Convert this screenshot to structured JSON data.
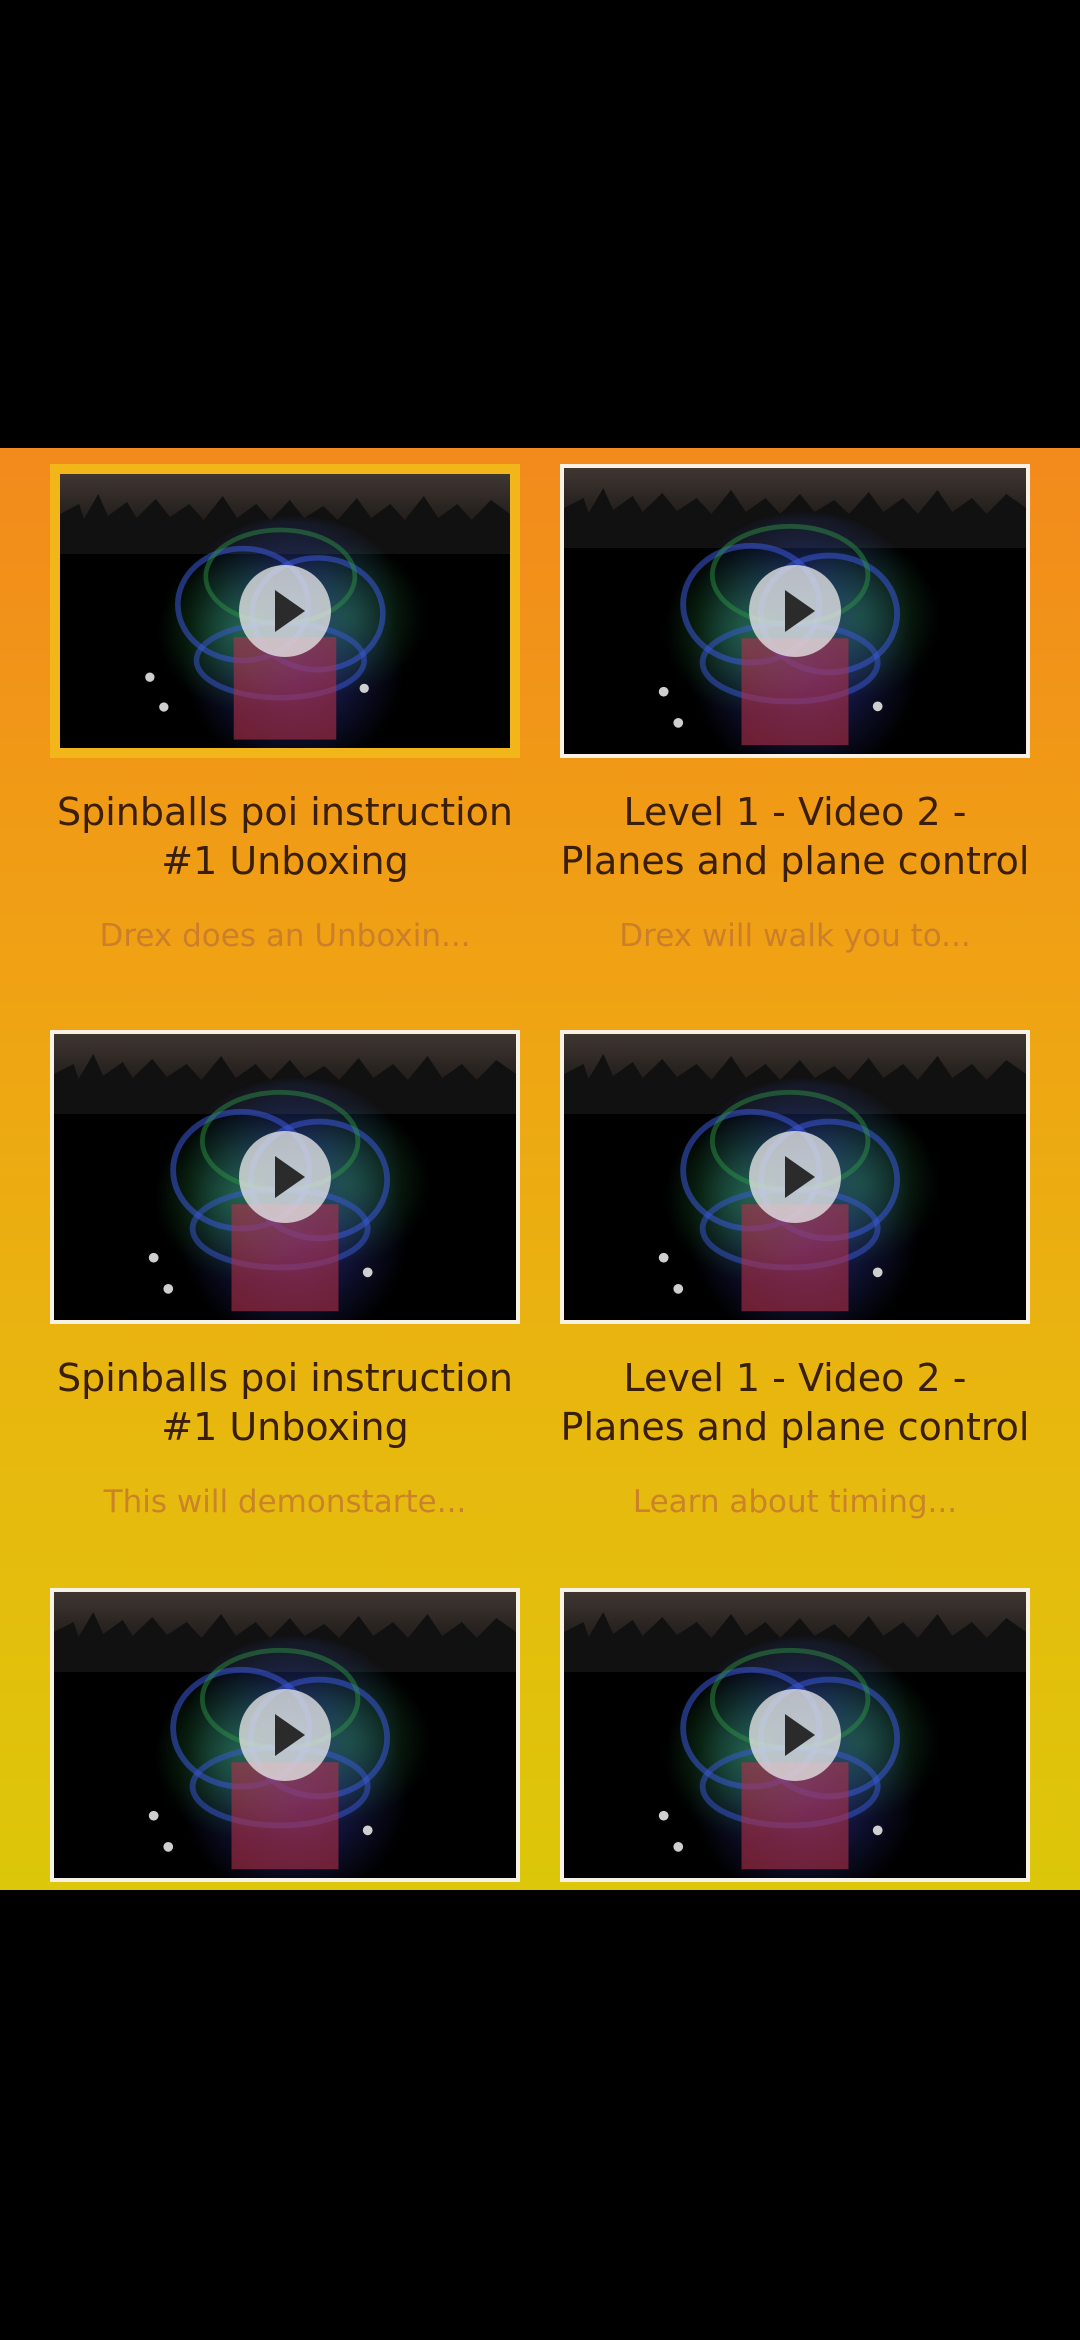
{
  "videos": [
    {
      "title": "Spinballs poi instruction #1 Unboxing",
      "description": "Drex does an Unboxin...",
      "selected": true
    },
    {
      "title": "Level 1 - Video 2 - Planes and plane control",
      "description": "Drex will walk you to...",
      "selected": false
    },
    {
      "title": "Spinballs poi instruction #1 Unboxing",
      "description": "This will demonstarte...",
      "selected": false
    },
    {
      "title": "Level 1 - Video 2 - Planes and plane control",
      "description": "Learn about timing...",
      "selected": false
    },
    {
      "title": "",
      "description": "",
      "selected": false
    },
    {
      "title": "",
      "description": "",
      "selected": false
    }
  ],
  "icons": {
    "play": "play-icon"
  },
  "colors": {
    "gradient_top": "#f28a1c",
    "gradient_bottom": "#dcc70a",
    "selected_border": "#f2b51a",
    "title_text": "#3a1f08",
    "description_text": "#c67a2e"
  }
}
